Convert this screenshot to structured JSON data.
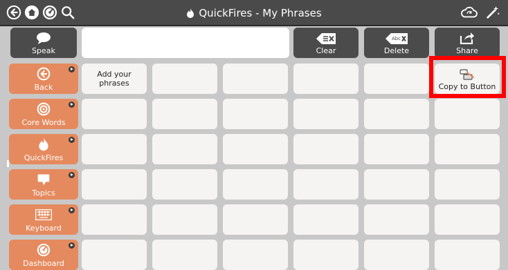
{
  "title_bar": {
    "title": "QuickFires - My Phrases",
    "icons": [
      "back-arrow-icon",
      "home-icon",
      "dashboard-icon",
      "search-icon",
      "cloud-sync-icon",
      "wand-icon"
    ]
  },
  "actions": {
    "speak": "Speak",
    "clear": "Clear",
    "delete": "Delete",
    "delete_key_text": "Abc",
    "share": "Share"
  },
  "message_bar": {
    "value": ""
  },
  "sidebar": [
    {
      "label": "Back",
      "icon": "back-arrow-icon"
    },
    {
      "label": "Core Words",
      "icon": "target-icon"
    },
    {
      "label": "QuickFires",
      "icon": "flame-icon"
    },
    {
      "label": "Topics",
      "icon": "speech-bubble-icon"
    },
    {
      "label": "Keyboard",
      "icon": "keyboard-icon"
    },
    {
      "label": "Dashboard",
      "icon": "dashboard-icon"
    }
  ],
  "grid": {
    "add_phrases": "Add your phrases",
    "copy_to_button": "Copy to Button"
  },
  "colors": {
    "title_bar": "#4a4a4a",
    "action_button": "#4b4b4b",
    "sidebar_button": "#e58a5e",
    "cell": "#f5f4f2",
    "highlight": "#ff0000"
  }
}
